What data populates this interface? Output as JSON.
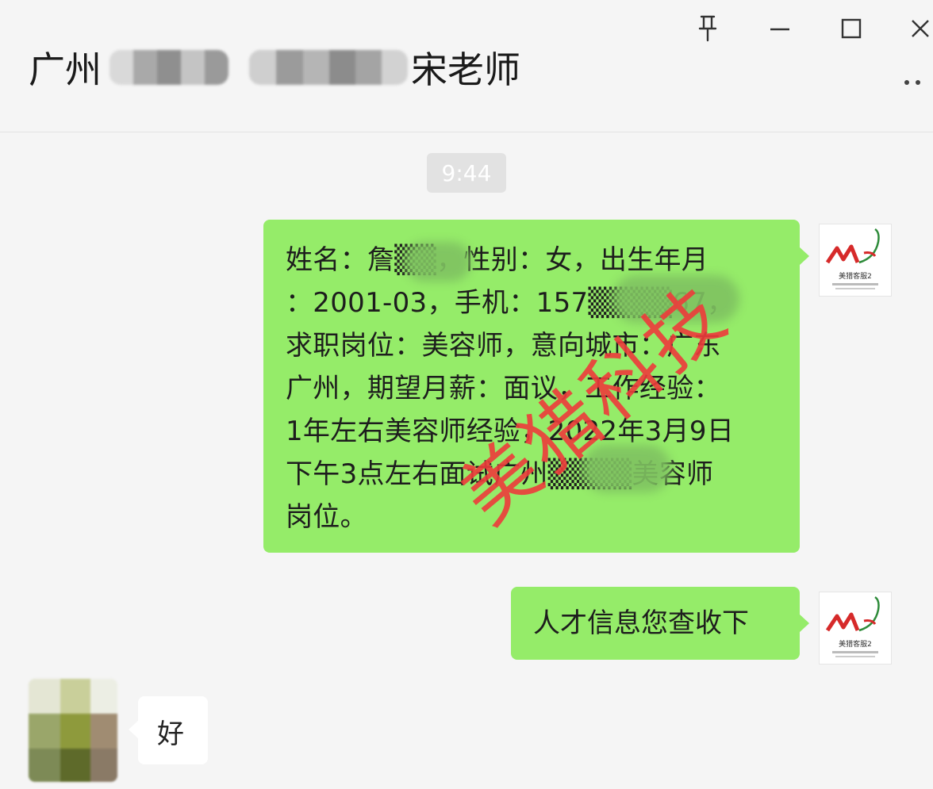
{
  "header": {
    "title_prefix": "广州",
    "title_suffix": "宋老师",
    "pin_icon": "pin-icon",
    "minimize_icon": "minimize-icon",
    "maximize_icon": "maximize-icon",
    "close_icon": "close-icon",
    "more_icon": "more-dots-icon"
  },
  "messages": {
    "time": "9:44",
    "msg1": "姓名：詹▒▒，性别：女，出生年月\n：2001-03，手机：157▒▒▒▒67，\n求职岗位：美容师，意向城市：广东\n广州，期望月薪：面议，工作经验：\n1年左右美容师经验，2022年3月9日\n下午3点左右面试广州▒▒▒▒美容师\n岗位。",
    "msg2": "人才信息您查收下",
    "msg3": "好"
  },
  "avatar": {
    "logo_text": "美猎客服2"
  },
  "watermark": "美猎科技",
  "colors": {
    "bubble_green": "#95ec69",
    "background": "#f5f5f5",
    "watermark_red": "#ee3b3b"
  }
}
